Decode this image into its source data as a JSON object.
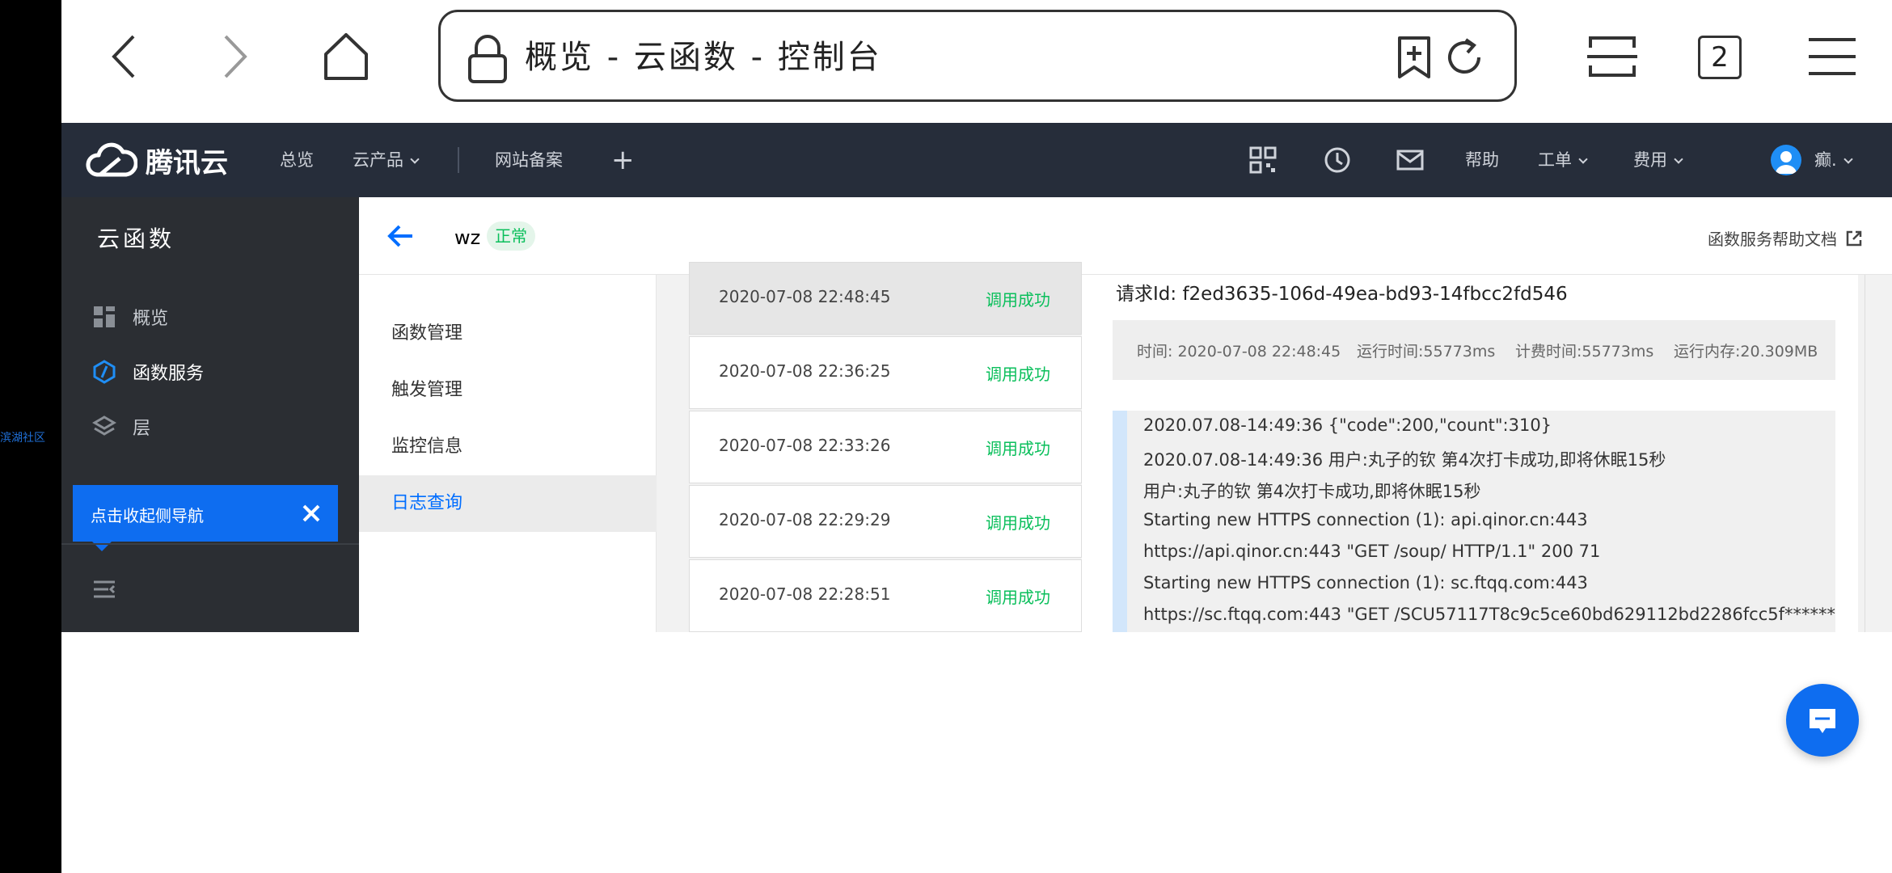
{
  "watermark": "滨湖社区",
  "browser": {
    "url_title": "概览 - 云函数 - 控制台",
    "tab_count": "2"
  },
  "topnav": {
    "logo_text": "腾讯云",
    "overview": "总览",
    "products": "云产品",
    "icp": "网站备案",
    "plus": "+",
    "help": "帮助",
    "ticket": "工单",
    "billing": "费用",
    "user": "癫."
  },
  "sidebar": {
    "title": "云函数",
    "items": [
      {
        "label": "概览"
      },
      {
        "label": "函数服务"
      },
      {
        "label": "层"
      }
    ],
    "tooltip": "点击收起侧导航"
  },
  "header": {
    "function_name": "wz",
    "status": "正常",
    "help_doc": "函数服务帮助文档"
  },
  "submenu": {
    "items": [
      {
        "label": "函数管理"
      },
      {
        "label": "触发管理"
      },
      {
        "label": "监控信息"
      },
      {
        "label": "日志查询"
      }
    ]
  },
  "logs": [
    {
      "time": "2020-07-08 22:48:45",
      "status": "调用成功"
    },
    {
      "time": "2020-07-08 22:36:25",
      "status": "调用成功"
    },
    {
      "time": "2020-07-08 22:33:26",
      "status": "调用成功"
    },
    {
      "time": "2020-07-08 22:29:29",
      "status": "调用成功"
    },
    {
      "time": "2020-07-08 22:28:51",
      "status": "调用成功"
    }
  ],
  "detail": {
    "request_id": "请求Id: f2ed3635-106d-49ea-bd93-14fbcc2fd546",
    "time": "时间: 2020-07-08 22:48:45",
    "run_time": "运行时间:55773ms",
    "billed_time": "计费时间:55773ms",
    "memory": "运行内存:20.309MB",
    "lines": [
      "2020.07.08-14:49:36    {\"code\":200,\"count\":310}",
      "2020.07.08-14:49:36    用户:丸子的钦   第4次打卡成功,即将休眠15秒",
      "用户:丸子的钦   第4次打卡成功,即将休眠15秒",
      "Starting new HTTPS connection (1): api.qinor.cn:443",
      "https://api.qinor.cn:443 \"GET /soup/ HTTP/1.1\" 200 71",
      "Starting new HTTPS connection (1): sc.ftqq.com:443",
      "https://sc.ftqq.com:443 \"GET /SCU57117T8c9c5ce60bd629112bd2286fcc5f******"
    ]
  },
  "colors": {
    "topnav_bg": "#262d3a",
    "sidebar_bg": "#2b2e33",
    "accent": "#006eff",
    "success": "#0abf5b"
  }
}
